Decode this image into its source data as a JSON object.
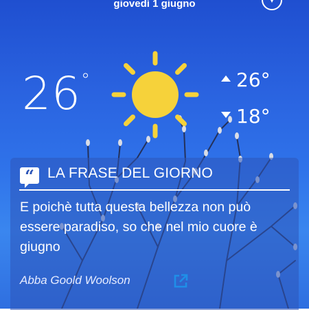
{
  "header": {
    "date": "giovedì 1 giugno",
    "menu_icon": "hamburger-menu-icon",
    "location_icon": "location-pin-icon"
  },
  "weather": {
    "current_temp": "26",
    "current_unit": "°",
    "max_temp": "26°",
    "min_temp": "18°",
    "condition_icon": "sun-icon",
    "sun_color": "#f6d23a"
  },
  "quote_card": {
    "badge_icon": "quote-icon",
    "badge_symbol": "“",
    "title": "LA FRASE DEL GIORNO",
    "text": "E poichè tutta questa bellezza non può essere paradiso, so che nel mio cuore è giugno",
    "author": "Abba Goold Woolson",
    "share_icon": "external-link-icon",
    "accent_color": "#1f8fe8"
  }
}
